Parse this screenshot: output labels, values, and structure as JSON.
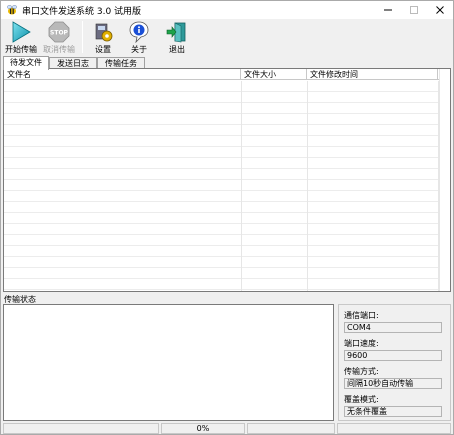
{
  "window": {
    "title": "串口文件发送系统 3.0 试用版"
  },
  "toolbar": {
    "start_label": "开始传输",
    "cancel_label": "取消传输",
    "settings_label": "设置",
    "about_label": "关于",
    "exit_label": "退出"
  },
  "tabs": [
    {
      "label": "待发文件",
      "active": true
    },
    {
      "label": "发送日志",
      "active": false
    },
    {
      "label": "传输任务",
      "active": false
    }
  ],
  "file_list": {
    "columns": [
      "文件名",
      "文件大小",
      "文件修改时间"
    ],
    "rows": []
  },
  "transfer_status": {
    "label": "传输状态"
  },
  "info": {
    "port_label": "通信端口:",
    "port_value": "COM4",
    "baud_label": "端口速度:",
    "baud_value": "9600",
    "mode_label": "传输方式:",
    "mode_value": "间隔10秒自动传输",
    "overwrite_label": "覆盖模式:",
    "overwrite_value": "无条件覆盖"
  },
  "statusbar": {
    "progress_text": "0%"
  },
  "icons": {
    "app": "bee-icon",
    "start": "play-triangle-icon",
    "cancel": "stop-sign-icon",
    "settings": "settings-gear-icon",
    "about": "info-icon",
    "exit": "exit-door-icon"
  }
}
